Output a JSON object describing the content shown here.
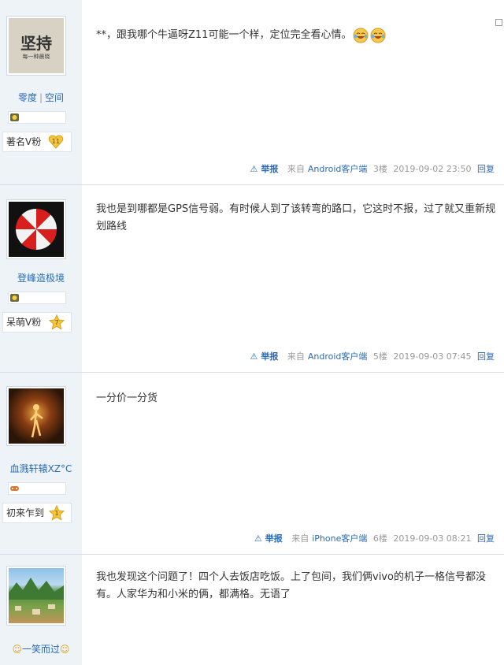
{
  "posts": [
    {
      "avatar_text_main": "坚持",
      "avatar_text_sub": "每一种晨晓",
      "user_links": [
        "零度",
        "空间"
      ],
      "rank_label": "著名V粉",
      "rank_level": "11",
      "content": "**，跟我哪个牛逼呀Z11可能一个样，定位完全看心情。",
      "emojis": [
        "laughing-crying-emoji",
        "laughing-crying-emoji"
      ],
      "report": "举报",
      "source_prefix": "来自",
      "source": "Android客户端",
      "floor": "3楼",
      "time": "2019-09-02 23:50",
      "reply": "回复"
    },
    {
      "user_name": "登峰造极境",
      "rank_label": "呆萌V粉",
      "rank_level": "7",
      "content": "我也是到哪都是GPS信号弱。有时候人到了该转弯的路口，它这时不报，过了就又重新规划路线",
      "report": "举报",
      "source_prefix": "来自",
      "source": "Android客户端",
      "floor": "5楼",
      "time": "2019-09-03 07:45",
      "reply": "回复"
    },
    {
      "user_name": "血溅轩辕XZ°C",
      "rank_label": "初来乍到",
      "rank_level": "1",
      "content": "一分价一分货",
      "report": "举报",
      "source_prefix": "来自",
      "source": "iPhone客户端",
      "floor": "6楼",
      "time": "2019-09-03 08:21",
      "reply": "回复"
    },
    {
      "user_name": "一笑而过",
      "content": "我也发现这个问题了！四个人去饭店吃饭。上了包间，我们俩vivo的机子一格信号都没有。人家华为和小米的俩，都满格。无语了"
    }
  ],
  "colors": {
    "link": "#2a6bb3",
    "sidebar_bg": "#eef3f8",
    "border": "#d6dde8"
  }
}
